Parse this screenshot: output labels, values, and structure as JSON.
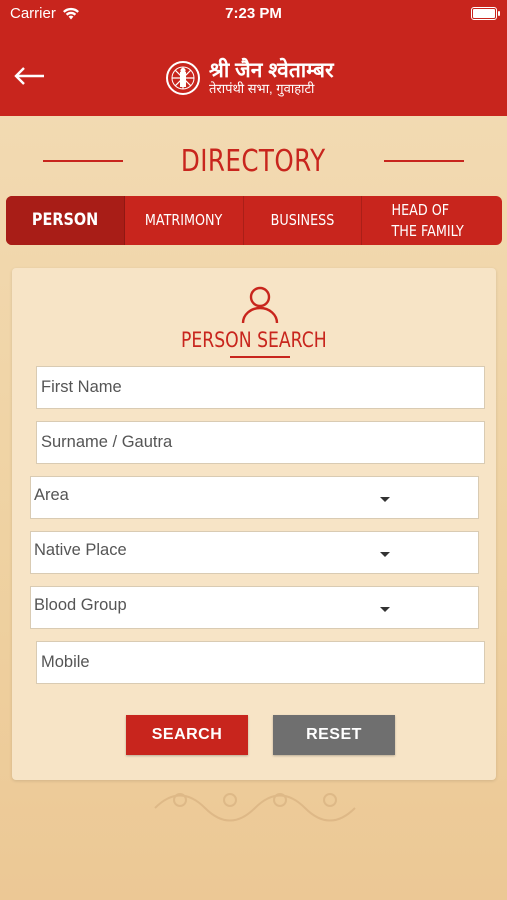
{
  "status_bar": {
    "carrier": "Carrier",
    "time": "7:23 PM"
  },
  "app_bar": {
    "logo_line1": "श्री जैन श्वेताम्बर",
    "logo_line2": "तेरापंथी सभा, गुवाहाटी"
  },
  "page": {
    "title": "DIRECTORY"
  },
  "tabs": [
    {
      "label": "PERSON",
      "active": true
    },
    {
      "label": "MATRIMONY",
      "active": false
    },
    {
      "label": "BUSINESS",
      "active": false
    },
    {
      "label": "HEAD OF THE FAMILY",
      "active": false
    }
  ],
  "search_form": {
    "title": "PERSON SEARCH",
    "first_name_placeholder": "First Name",
    "surname_placeholder": "Surname / Gautra",
    "area_label": "Area",
    "native_place_label": "Native Place",
    "blood_group_label": "Blood Group",
    "mobile_placeholder": "Mobile",
    "search_label": "SEARCH",
    "reset_label": "RESET"
  },
  "icons": {
    "back": "back-arrow-icon",
    "wifi": "wifi-icon",
    "battery": "battery-icon",
    "person": "person-icon",
    "logo": "emblem-icon",
    "dropdown": "chevron-down-icon"
  },
  "colors": {
    "primary": "#c8251d",
    "active_tab": "#a81d17",
    "reset_button": "#6f6f6f",
    "background": "#f3dcb6",
    "card": "#f7e4c6"
  }
}
